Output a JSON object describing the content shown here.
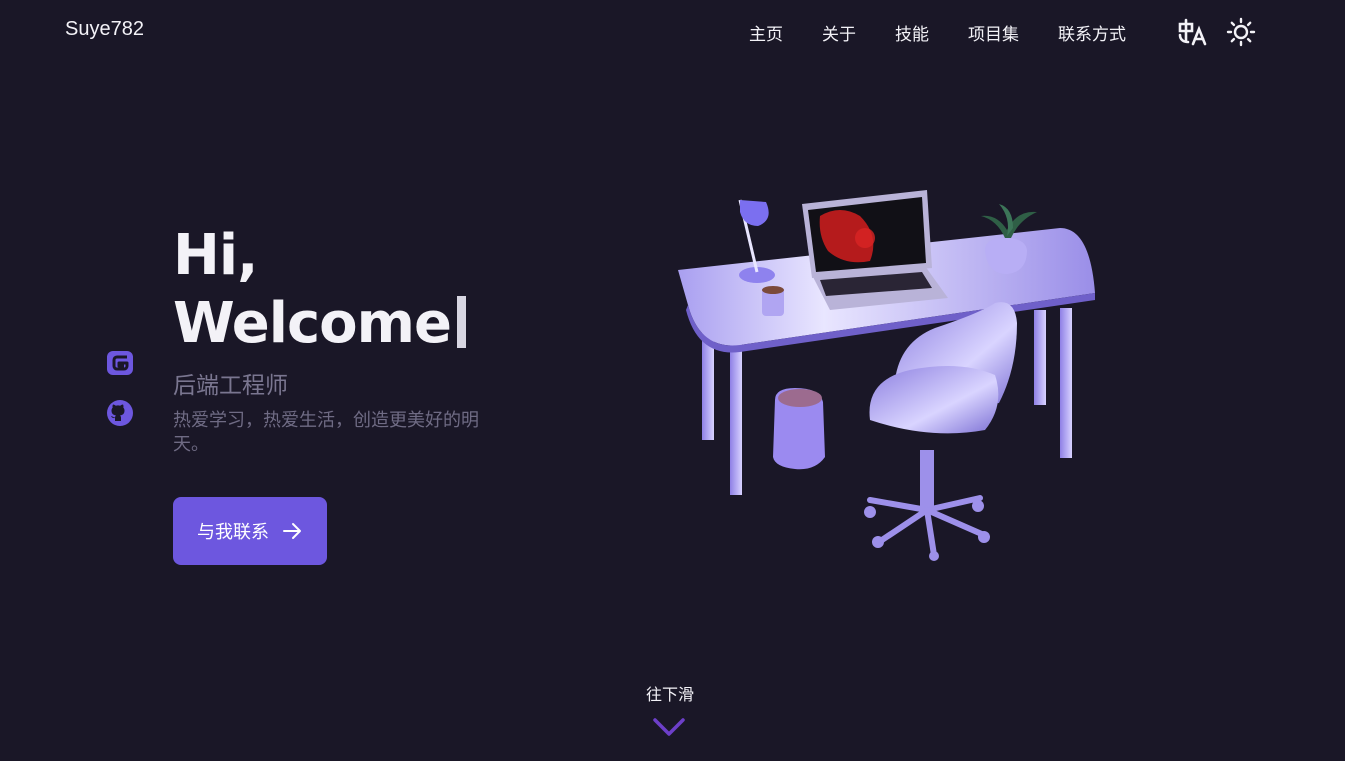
{
  "header": {
    "brand": "Suye782",
    "nav": [
      "主页",
      "关于",
      "技能",
      "项目集",
      "联系方式"
    ],
    "icons": {
      "language": "translate-icon",
      "theme": "sun-icon"
    }
  },
  "social": {
    "icons": [
      "gitee-icon",
      "github-icon"
    ],
    "accent": "#6d57df"
  },
  "hero": {
    "greeting": "Hi,",
    "welcome": "Welcome",
    "role": "后端工程师",
    "description": "热爱学习，热爱生活，创造更美好的明天。",
    "cta_label": "与我联系"
  },
  "scroll": {
    "label": "往下滑"
  },
  "colors": {
    "background": "#1a1727",
    "accent": "#6d57df",
    "text": "#f3f2f7",
    "muted": "#7a7690"
  }
}
